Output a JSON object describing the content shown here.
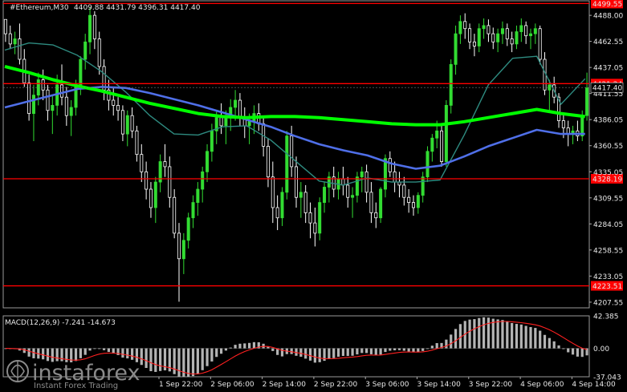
{
  "header": {
    "symbol": "#Ethereum,M30",
    "ohlc": "4409.88 4431.79 4396.31 4417.40"
  },
  "macd": {
    "label": "MACD(12,26,9) -7.241 -14.673",
    "ticks": [
      42.385,
      0.0,
      -37.043
    ],
    "tick_labels": [
      "42.385",
      "0.00",
      "-37.043"
    ],
    "ylim": [
      -37.043,
      42.385
    ]
  },
  "watermark": {
    "brand": "instaforex",
    "tagline": "Instant Forex Trading"
  },
  "colors": {
    "background": "#000000",
    "bull": "#32dc32",
    "bear": "#ffffff",
    "ma_slow": "#00ff00",
    "ma_mid": "#4f6fe8",
    "ma_fast": "#2e8b80",
    "level": "#ff0000",
    "macd_hist": "#b4b4b4",
    "macd_signal": "#ff2020"
  },
  "chart_data": {
    "type": "candlestick",
    "title": "",
    "y_ticks": [
      4488.0,
      4462.55,
      4437.05,
      4411.55,
      4386.05,
      4360.55,
      4335.05,
      4309.55,
      4284.05,
      4258.55,
      4233.05,
      4207.55
    ],
    "y_tick_labels": [
      "4488.00",
      "4462.55",
      "4437.05",
      "4411.55",
      "4386.05",
      "4360.55",
      "4335.05",
      "4309.55",
      "4284.05",
      "4258.55",
      "4233.05",
      "4207.55"
    ],
    "ylim": [
      4202.0,
      4503.0
    ],
    "x_labels": [
      "1 Sep 22:00",
      "2 Sep 06:00",
      "2 Sep 14:00",
      "2 Sep 22:00",
      "3 Sep 06:00",
      "3 Sep 14:00",
      "3 Sep 22:00",
      "4 Sep 06:00",
      "4 Sep 14:00"
    ],
    "levels": [
      {
        "value": 4499.55,
        "label": "4499.55"
      },
      {
        "value": 4421.24,
        "label": "4421.24"
      },
      {
        "value": 4328.19,
        "label": "4328.19"
      },
      {
        "value": 4223.51,
        "label": "4223.51"
      }
    ],
    "current_price": {
      "value": 4417.4,
      "label": "4417.40"
    },
    "ma_slow": [
      4438,
      4432,
      4425,
      4419,
      4414,
      4408,
      4402,
      4397,
      4392,
      4389,
      4388,
      4389,
      4389,
      4388,
      4386,
      4384,
      4382,
      4381,
      4381,
      4384,
      4388,
      4392,
      4396,
      4392,
      4389
    ],
    "ma_mid": [
      4398,
      4404,
      4410,
      4416,
      4418,
      4417,
      4412,
      4406,
      4400,
      4393,
      4386,
      4379,
      4370,
      4362,
      4356,
      4351,
      4343,
      4338,
      4341,
      4350,
      4360,
      4368,
      4376,
      4372,
      4372
    ],
    "ma_fast": [
      4454,
      4461,
      4459,
      4449,
      4433,
      4413,
      4390,
      4372,
      4371,
      4379,
      4380,
      4366,
      4346,
      4326,
      4322,
      4329,
      4325,
      4325,
      4327,
      4371,
      4420,
      4446,
      4448,
      4401,
      4426
    ],
    "candles": [
      [
        4484,
        4484,
        4462,
        4470
      ],
      [
        4470,
        4478,
        4455,
        4460
      ],
      [
        4460,
        4472,
        4450,
        4465
      ],
      [
        4465,
        4480,
        4440,
        4445
      ],
      [
        4445,
        4455,
        4418,
        4422
      ],
      [
        4422,
        4430,
        4385,
        4392
      ],
      [
        4392,
        4420,
        4365,
        4410
      ],
      [
        4410,
        4432,
        4400,
        4425
      ],
      [
        4425,
        4435,
        4405,
        4415
      ],
      [
        4415,
        4420,
        4385,
        4395
      ],
      [
        4395,
        4410,
        4372,
        4400
      ],
      [
        4400,
        4430,
        4390,
        4420
      ],
      [
        4420,
        4440,
        4400,
        4408
      ],
      [
        4408,
        4418,
        4380,
        4390
      ],
      [
        4390,
        4405,
        4370,
        4398
      ],
      [
        4398,
        4425,
        4390,
        4418
      ],
      [
        4418,
        4448,
        4410,
        4445
      ],
      [
        4445,
        4470,
        4435,
        4462
      ],
      [
        4462,
        4496,
        4450,
        4488
      ],
      [
        4488,
        4492,
        4455,
        4465
      ],
      [
        4465,
        4472,
        4430,
        4438
      ],
      [
        4438,
        4445,
        4405,
        4415
      ],
      [
        4415,
        4425,
        4395,
        4405
      ],
      [
        4405,
        4418,
        4390,
        4400
      ],
      [
        4400,
        4408,
        4385,
        4395
      ],
      [
        4395,
        4400,
        4365,
        4372
      ],
      [
        4372,
        4395,
        4360,
        4390
      ],
      [
        4390,
        4398,
        4368,
        4375
      ],
      [
        4375,
        4380,
        4345,
        4352
      ],
      [
        4352,
        4362,
        4325,
        4335
      ],
      [
        4335,
        4345,
        4308,
        4318
      ],
      [
        4318,
        4325,
        4290,
        4300
      ],
      [
        4300,
        4330,
        4285,
        4325
      ],
      [
        4325,
        4352,
        4315,
        4345
      ],
      [
        4345,
        4362,
        4330,
        4340
      ],
      [
        4340,
        4350,
        4300,
        4310
      ],
      [
        4310,
        4318,
        4270,
        4275
      ],
      [
        4275,
        4285,
        4208,
        4250
      ],
      [
        4250,
        4275,
        4235,
        4268
      ],
      [
        4268,
        4295,
        4260,
        4290
      ],
      [
        4290,
        4312,
        4280,
        4305
      ],
      [
        4305,
        4325,
        4292,
        4318
      ],
      [
        4318,
        4340,
        4305,
        4335
      ],
      [
        4335,
        4362,
        4325,
        4355
      ],
      [
        4355,
        4382,
        4345,
        4375
      ],
      [
        4375,
        4395,
        4362,
        4388
      ],
      [
        4388,
        4402,
        4372,
        4380
      ],
      [
        4380,
        4395,
        4362,
        4390
      ],
      [
        4390,
        4406,
        4375,
        4398
      ],
      [
        4398,
        4415,
        4385,
        4405
      ],
      [
        4405,
        4412,
        4380,
        4388
      ],
      [
        4388,
        4398,
        4368,
        4380
      ],
      [
        4380,
        4392,
        4362,
        4385
      ],
      [
        4385,
        4400,
        4372,
        4392
      ],
      [
        4392,
        4402,
        4375,
        4382
      ],
      [
        4382,
        4388,
        4350,
        4360
      ],
      [
        4360,
        4368,
        4320,
        4330
      ],
      [
        4330,
        4345,
        4285,
        4300
      ],
      [
        4300,
        4312,
        4278,
        4290
      ],
      [
        4290,
        4320,
        4282,
        4315
      ],
      [
        4315,
        4375,
        4308,
        4370
      ],
      [
        4370,
        4380,
        4330,
        4340
      ],
      [
        4340,
        4350,
        4300,
        4310
      ],
      [
        4310,
        4325,
        4290,
        4315
      ],
      [
        4315,
        4322,
        4285,
        4295
      ],
      [
        4295,
        4305,
        4270,
        4285
      ],
      [
        4285,
        4300,
        4262,
        4275
      ],
      [
        4275,
        4310,
        4268,
        4305
      ],
      [
        4305,
        4325,
        4295,
        4320
      ],
      [
        4320,
        4335,
        4305,
        4330
      ],
      [
        4330,
        4340,
        4310,
        4318
      ],
      [
        4318,
        4335,
        4308,
        4328
      ],
      [
        4328,
        4340,
        4312,
        4322
      ],
      [
        4322,
        4330,
        4300,
        4310
      ],
      [
        4310,
        4320,
        4290,
        4312
      ],
      [
        4312,
        4335,
        4305,
        4330
      ],
      [
        4330,
        4340,
        4315,
        4335
      ],
      [
        4335,
        4342,
        4305,
        4315
      ],
      [
        4315,
        4325,
        4285,
        4295
      ],
      [
        4295,
        4305,
        4280,
        4290
      ],
      [
        4290,
        4320,
        4285,
        4318
      ],
      [
        4318,
        4352,
        4310,
        4348
      ],
      [
        4348,
        4355,
        4330,
        4335
      ],
      [
        4335,
        4345,
        4315,
        4325
      ],
      [
        4325,
        4335,
        4310,
        4322
      ],
      [
        4322,
        4330,
        4302,
        4310
      ],
      [
        4310,
        4318,
        4295,
        4305
      ],
      [
        4305,
        4312,
        4292,
        4300
      ],
      [
        4300,
        4315,
        4294,
        4312
      ],
      [
        4312,
        4335,
        4305,
        4330
      ],
      [
        4330,
        4360,
        4325,
        4355
      ],
      [
        4355,
        4372,
        4345,
        4368
      ],
      [
        4368,
        4385,
        4358,
        4375
      ],
      [
        4375,
        4380,
        4340,
        4345
      ],
      [
        4345,
        4405,
        4340,
        4400
      ],
      [
        4400,
        4445,
        4392,
        4440
      ],
      [
        4440,
        4478,
        4430,
        4470
      ],
      [
        4470,
        4488,
        4460,
        4482
      ],
      [
        4482,
        4490,
        4465,
        4475
      ],
      [
        4475,
        4480,
        4455,
        4462
      ],
      [
        4462,
        4470,
        4448,
        4458
      ],
      [
        4458,
        4480,
        4452,
        4475
      ],
      [
        4475,
        4485,
        4465,
        4478
      ],
      [
        4478,
        4484,
        4462,
        4470
      ],
      [
        4470,
        4476,
        4455,
        4462
      ],
      [
        4462,
        4475,
        4452,
        4470
      ],
      [
        4470,
        4482,
        4460,
        4475
      ],
      [
        4475,
        4480,
        4458,
        4465
      ],
      [
        4465,
        4472,
        4452,
        4460
      ],
      [
        4460,
        4478,
        4455,
        4472
      ],
      [
        4472,
        4485,
        4462,
        4478
      ],
      [
        4478,
        4482,
        4460,
        4468
      ],
      [
        4468,
        4475,
        4455,
        4470
      ],
      [
        4470,
        4480,
        4460,
        4475
      ],
      [
        4475,
        4478,
        4440,
        4445
      ],
      [
        4445,
        4452,
        4410,
        4415
      ],
      [
        4415,
        4425,
        4395,
        4420
      ],
      [
        4420,
        4428,
        4402,
        4408
      ],
      [
        4408,
        4412,
        4378,
        4385
      ],
      [
        4385,
        4392,
        4368,
        4378
      ],
      [
        4378,
        4385,
        4360,
        4372
      ],
      [
        4372,
        4380,
        4362,
        4375
      ],
      [
        4375,
        4385,
        4365,
        4370
      ],
      [
        4370,
        4395,
        4365,
        4390
      ],
      [
        4390,
        4432,
        4385,
        4417
      ]
    ]
  }
}
